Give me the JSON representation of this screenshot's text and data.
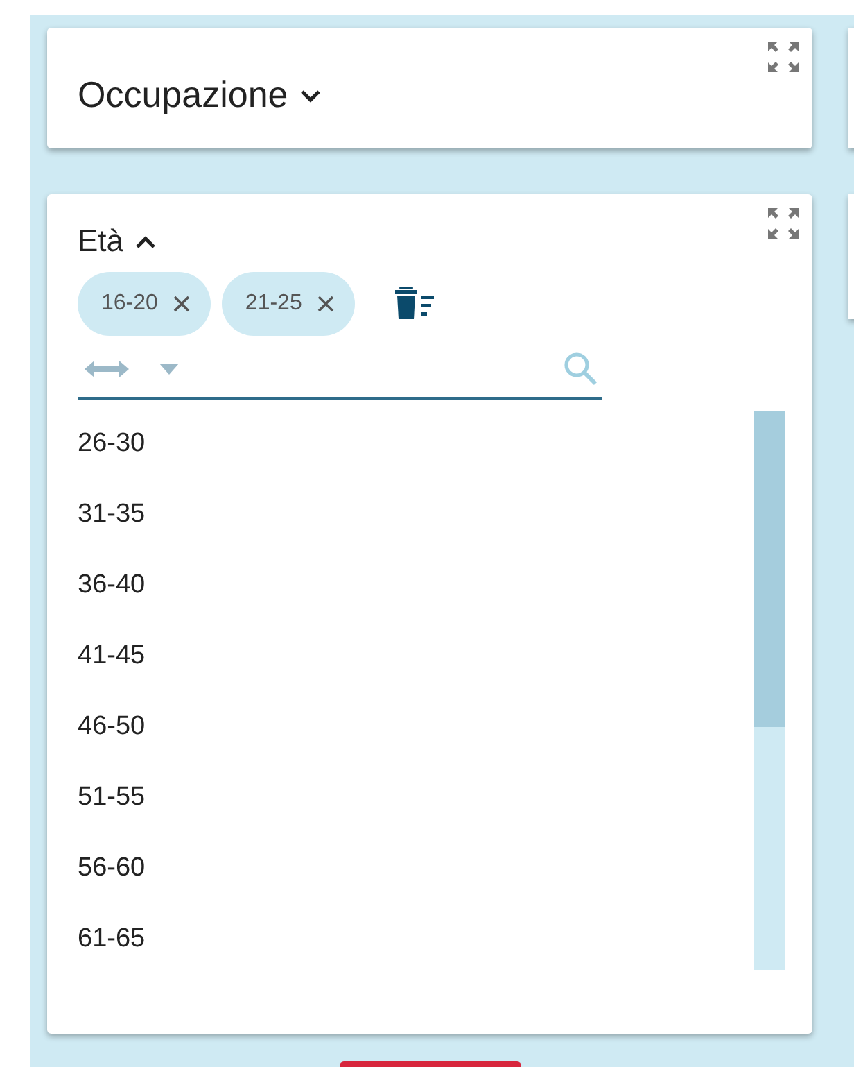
{
  "panels": [
    {
      "title": "Occupazione",
      "expanded": false
    },
    {
      "title": "Età",
      "expanded": true,
      "chips": [
        {
          "label": "16-20"
        },
        {
          "label": "21-25"
        }
      ],
      "options": [
        "26-30",
        "31-35",
        "36-40",
        "41-45",
        "46-50",
        "51-55",
        "56-60",
        "61-65"
      ]
    }
  ]
}
